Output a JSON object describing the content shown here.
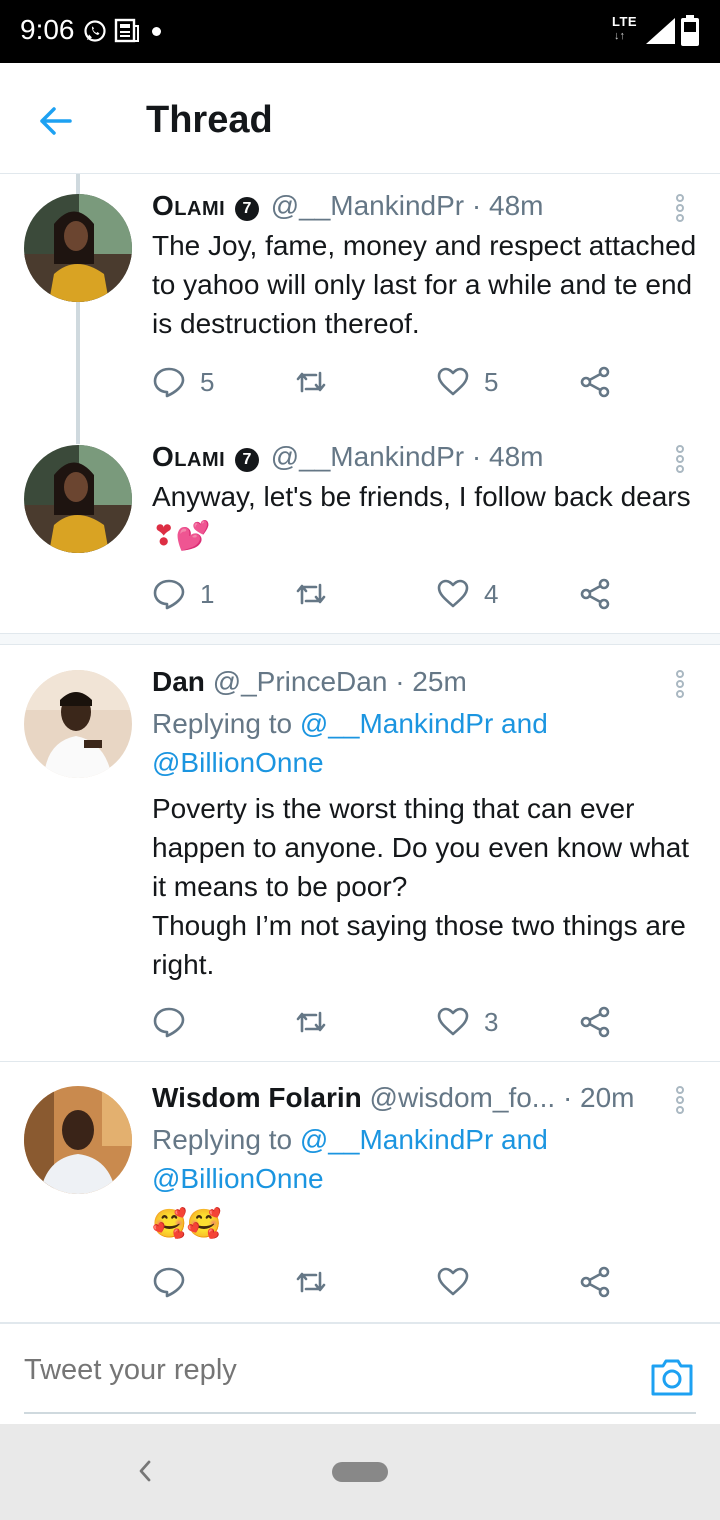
{
  "status_bar": {
    "time": "9:06",
    "network": "LTE",
    "icons": [
      "whatsapp-icon",
      "news-icon",
      "notification-dot",
      "signal-icon",
      "battery-icon"
    ]
  },
  "header": {
    "title": "Thread",
    "back_icon": "arrow-left-icon"
  },
  "tweets": [
    {
      "name": "Olami",
      "badge": "7",
      "handle": "@__MankindPr",
      "time": "· 48m",
      "text": "The Joy, fame, money and respect attached to yahoo will only last for a while and te end is destruction thereof.",
      "replies": "5",
      "retweets": "",
      "likes": "5"
    },
    {
      "name": "Olami",
      "badge": "7",
      "handle": "@__MankindPr",
      "time": "· 48m",
      "text": "Anyway, let's be friends, I follow back dears",
      "emoji": "❣💕",
      "replies": "1",
      "retweets": "",
      "likes": "4"
    },
    {
      "name": "Dan",
      "handle": "@_PrinceDan",
      "time": "· 25m",
      "reply_prefix": "Replying to ",
      "reply_users": "@__MankindPr and @BillionOnne",
      "text_lines": [
        "Poverty is the worst thing that can ever happen to anyone. Do you even know what it means to be poor?",
        "Though I’m not saying those two things are right."
      ],
      "replies": "",
      "retweets": "",
      "likes": "3"
    },
    {
      "name": "Wisdom Folarin",
      "handle": "@wisdom_fo...",
      "time": "· 20m",
      "reply_prefix": "Replying to ",
      "reply_users": "@__MankindPr and @BillionOnne",
      "emoji": "🥰🥰",
      "replies": "",
      "retweets": "",
      "likes": ""
    }
  ],
  "reply_bar": {
    "placeholder": "Tweet your reply",
    "camera_icon": "camera-icon"
  },
  "colors": {
    "accent": "#1da1f2",
    "link": "#1b95e0",
    "muted": "#657786",
    "text": "#14171a"
  }
}
